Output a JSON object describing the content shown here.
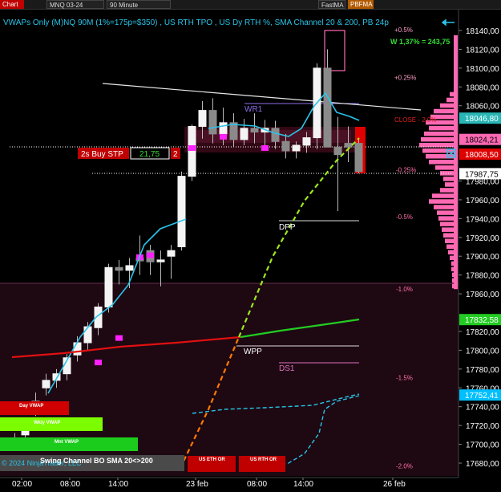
{
  "toolbar": {
    "chart_tab": "Chart",
    "instrument": "MNQ 03-24",
    "period": "90 Minute",
    "fastma": "FastMA",
    "pbfma": "PBFMA"
  },
  "chart_data": {
    "type": "candlestick",
    "title": "VWAPs Only (M)NQ 90M  (1%=175p=$350) , US RTH TPO , US Dy RTH %, SMA Channel 20 & 200, PB 24p",
    "y_axis": {
      "ylim": [
        17670,
        18150
      ],
      "ticks": [
        18140,
        18120,
        18100,
        18080,
        18060,
        17980,
        17960,
        17940,
        17920,
        17900,
        17880,
        17860,
        17820,
        17800,
        17780,
        17760,
        17740,
        17720,
        17700,
        17680
      ],
      "tick_labels": [
        "18140,00",
        "18120,00",
        "18100,00",
        "18080,00",
        "18060,00",
        "17980,00",
        "17960,00",
        "17940,00",
        "17920,00",
        "17900,00",
        "17880,00",
        "17860,00",
        "17820,00",
        "17800,00",
        "17780,00",
        "17760,00",
        "17740,00",
        "17720,00",
        "17700,00",
        "17680,00"
      ]
    },
    "x_axis": {
      "labels": [
        "02:00",
        "08:00",
        "14:00",
        "23 feb",
        "08:00",
        "14:00",
        "26 feb"
      ]
    },
    "price_flags": [
      {
        "label": "18046,80",
        "value": 18046.8,
        "color": "#29b6b6"
      },
      {
        "label": "18024,21",
        "value": 18024.2,
        "color": "#ff69b4"
      },
      {
        "label": "18008,50",
        "value": 18008.5,
        "color": "#e00000"
      },
      {
        "label": "17987,75",
        "value": 17987.75,
        "color": "#ffffff"
      },
      {
        "label": "17832,58",
        "value": 17832.6,
        "color": "#22cc22"
      },
      {
        "label": "17752,41",
        "value": 17752.4,
        "color": "#00bfff"
      }
    ],
    "pct_levels": [
      {
        "label": "+0.5%",
        "value": 18141
      },
      {
        "label": "+0.25%",
        "value": 18090
      },
      {
        "label": "-0.25%",
        "value": 17992
      },
      {
        "label": "-0.5%",
        "value": 17942
      },
      {
        "label": "-1.0%",
        "value": 17865
      },
      {
        "label": "-1.5%",
        "value": 17771
      },
      {
        "label": "-2.0%",
        "value": 17677
      }
    ],
    "annotations": {
      "week_pct": "W 1,37% = 243,75",
      "close_label": "CLOSE - 2,0%",
      "wr1": "WR1",
      "dpp": "DPP",
      "wpp": "WPP",
      "ds1": "DS1",
      "buy_stop": "2s Buy STP",
      "buy_stop_value": "21,75",
      "buy_stop_qty": "2",
      "day_vwap": "Day VWAP",
      "wkly_vwap": "Wkly VWAP",
      "mnt_vwap": "Mnt VWAP",
      "us_eth_or": "US ETH OR",
      "us_rth_or": "US RTH OR",
      "copyright": "© 2024 NinjaTrader, LLC",
      "swing_channel": "Swing Channel BO SMA 20<>200"
    },
    "candles": [
      {
        "o": 17700,
        "h": 17712,
        "l": 17694,
        "c": 17703
      },
      {
        "o": 17710,
        "h": 17720,
        "l": 17700,
        "c": 17714
      },
      {
        "o": 17746,
        "h": 17755,
        "l": 17730,
        "c": 17740
      },
      {
        "o": 17760,
        "h": 17775,
        "l": 17752,
        "c": 17768
      },
      {
        "o": 17768,
        "h": 17780,
        "l": 17760,
        "c": 17775
      },
      {
        "o": 17775,
        "h": 17796,
        "l": 17768,
        "c": 17792
      },
      {
        "o": 17795,
        "h": 17815,
        "l": 17788,
        "c": 17808
      },
      {
        "o": 17808,
        "h": 17830,
        "l": 17800,
        "c": 17825
      },
      {
        "o": 17824,
        "h": 17850,
        "l": 17816,
        "c": 17846
      },
      {
        "o": 17846,
        "h": 17892,
        "l": 17840,
        "c": 17888
      },
      {
        "o": 17888,
        "h": 17896,
        "l": 17870,
        "c": 17885
      },
      {
        "o": 17885,
        "h": 17898,
        "l": 17866,
        "c": 17890
      },
      {
        "o": 17898,
        "h": 17922,
        "l": 17880,
        "c": 17895
      },
      {
        "o": 17906,
        "h": 17912,
        "l": 17880,
        "c": 17894
      },
      {
        "o": 17894,
        "h": 17906,
        "l": 17868,
        "c": 17896
      },
      {
        "o": 17900,
        "h": 17912,
        "l": 17876,
        "c": 17906
      },
      {
        "o": 17910,
        "h": 17990,
        "l": 17906,
        "c": 17985
      },
      {
        "o": 17985,
        "h": 18040,
        "l": 17980,
        "c": 18038
      },
      {
        "o": 18038,
        "h": 18065,
        "l": 18025,
        "c": 18055
      },
      {
        "o": 18055,
        "h": 18068,
        "l": 18020,
        "c": 18030
      },
      {
        "o": 18030,
        "h": 18058,
        "l": 18018,
        "c": 18042
      },
      {
        "o": 18042,
        "h": 18052,
        "l": 18016,
        "c": 18024
      },
      {
        "o": 18024,
        "h": 18046,
        "l": 18018,
        "c": 18036
      },
      {
        "o": 18036,
        "h": 18052,
        "l": 18020,
        "c": 18032
      },
      {
        "o": 18032,
        "h": 18045,
        "l": 18018,
        "c": 18036
      },
      {
        "o": 18036,
        "h": 18044,
        "l": 18014,
        "c": 18022
      },
      {
        "o": 18022,
        "h": 18030,
        "l": 18004,
        "c": 18012
      },
      {
        "o": 18012,
        "h": 18022,
        "l": 18004,
        "c": 18018
      },
      {
        "o": 18018,
        "h": 18032,
        "l": 18010,
        "c": 18026
      },
      {
        "o": 18026,
        "h": 18105,
        "l": 18014,
        "c": 18100
      },
      {
        "o": 18100,
        "h": 18120,
        "l": 18020,
        "c": 18016
      },
      {
        "o": 18016,
        "h": 18048,
        "l": 17948,
        "c": 18008
      },
      {
        "o": 18020,
        "h": 18038,
        "l": 18000,
        "c": 18016
      },
      {
        "o": 18020,
        "h": 18024,
        "l": 17988,
        "c": 17990
      }
    ]
  }
}
